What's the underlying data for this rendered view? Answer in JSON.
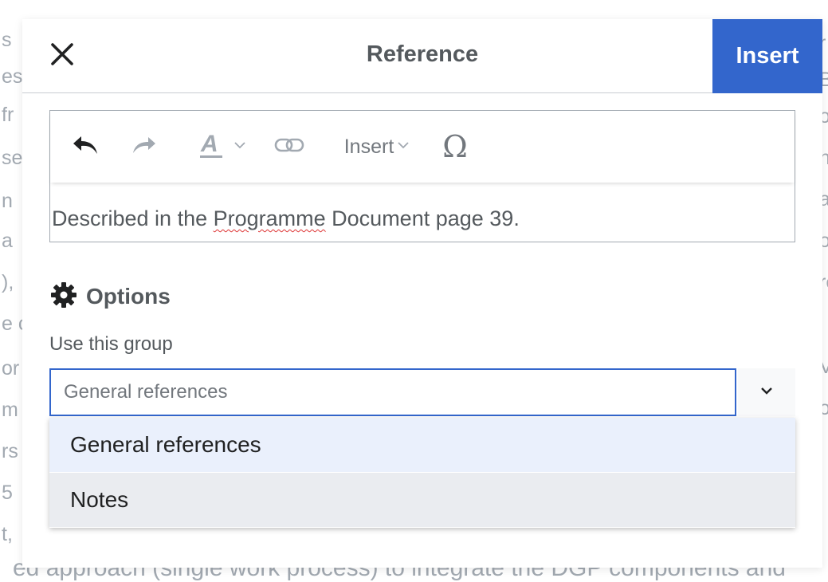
{
  "background": {
    "left_fragments": [
      "s",
      "es",
      "fr",
      "se",
      "n",
      "a",
      "),",
      "e c",
      "or",
      "m",
      "rs",
      "5",
      "t,"
    ],
    "right_fragments": [
      "r",
      "B",
      "or",
      "n",
      "a",
      "or",
      "re",
      "",
      "V",
      "o",
      "",
      "",
      ""
    ],
    "bottom_line": "ed approach (single work process) to integrate the DGP components and"
  },
  "dialog": {
    "title": "Reference",
    "close_label": "Close",
    "insert_label": "Insert"
  },
  "toolbar": {
    "undo_icon": "undo-icon",
    "redo_icon": "redo-icon",
    "style_icon": "text-style-icon",
    "link_icon": "link-icon",
    "insert_menu_label": "Insert",
    "special_char_label": "Ω"
  },
  "editor": {
    "text_before": "Described in the ",
    "text_misspelled": "Programme",
    "text_after": " Document page 39."
  },
  "options": {
    "title": "Options",
    "group_label": "Use this group",
    "group_value": "General references",
    "dropdown_options": [
      "General references",
      "Notes"
    ]
  },
  "colors": {
    "accent": "#3366cc",
    "title_text": "#54595d",
    "highlight": "#eaf0fc"
  }
}
